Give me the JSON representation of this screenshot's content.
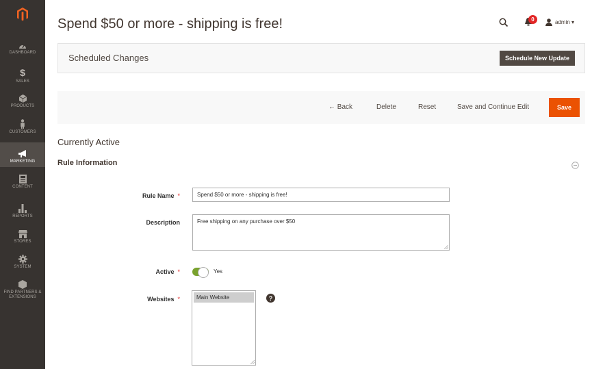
{
  "page_title": "Spend $50 or more - shipping is free!",
  "header": {
    "notification_count": "0",
    "user": "admin ▾"
  },
  "sidebar": {
    "items": [
      {
        "label": "DASHBOARD",
        "icon": "dashboard-icon"
      },
      {
        "label": "SALES",
        "icon": "dollar-icon"
      },
      {
        "label": "PRODUCTS",
        "icon": "cube-icon"
      },
      {
        "label": "CUSTOMERS",
        "icon": "person-icon"
      },
      {
        "label": "MARKETING",
        "icon": "megaphone-icon"
      },
      {
        "label": "CONTENT",
        "icon": "content-icon"
      },
      {
        "label": "REPORTS",
        "icon": "bar-chart-icon"
      },
      {
        "label": "STORES",
        "icon": "store-icon"
      },
      {
        "label": "SYSTEM",
        "icon": "gear-icon"
      },
      {
        "label": "FIND PARTNERS & EXTENSIONS",
        "icon": "extensions-icon"
      }
    ],
    "active": "MARKETING"
  },
  "scheduled": {
    "title": "Scheduled Changes",
    "button": "Schedule New Update"
  },
  "actions": {
    "back": "← Back",
    "delete": "Delete",
    "reset": "Reset",
    "save_continue": "Save and Continue Edit",
    "save": "Save"
  },
  "section": {
    "currently_active": "Currently Active",
    "rule_information": "Rule Information"
  },
  "form": {
    "rule_name_label": "Rule Name",
    "rule_name_value": "Spend $50 or more - shipping is free!",
    "description_label": "Description",
    "description_value": "Free shipping on any purchase over $50",
    "active_label": "Active",
    "active_value": "Yes",
    "websites_label": "Websites",
    "websites_option": "Main Website",
    "required_mark": "*"
  },
  "colors": {
    "sidebar_bg": "#373330",
    "accent": "#eb5202",
    "toggle_on": "#79a22e",
    "badge": "#e22626"
  }
}
